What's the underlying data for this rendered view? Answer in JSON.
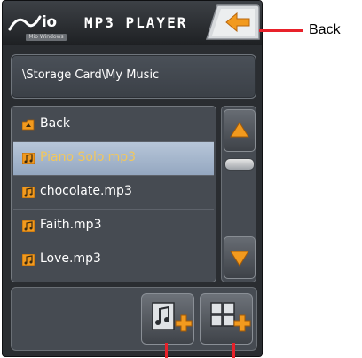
{
  "header": {
    "logo_text": "io",
    "logo_subtext": "Mio Windows",
    "title": "MP3 PLAYER",
    "back_icon": "back-arrow-icon"
  },
  "path": {
    "text": "\\Storage Card\\My Music"
  },
  "list": {
    "items": [
      {
        "label": "Back",
        "icon": "folder-up-icon",
        "selected": false
      },
      {
        "label": "Piano Solo.mp3",
        "icon": "music-file-icon",
        "selected": true
      },
      {
        "label": "chocolate.mp3",
        "icon": "music-file-icon",
        "selected": false
      },
      {
        "label": "Faith.mp3",
        "icon": "music-file-icon",
        "selected": false
      },
      {
        "label": "Love.mp3",
        "icon": "music-file-icon",
        "selected": false
      }
    ]
  },
  "scroll": {
    "up_icon": "arrow-up-icon",
    "down_icon": "arrow-down-icon"
  },
  "toolbar": {
    "add_song_icon": "add-song-icon",
    "add_playlist_icon": "add-playlist-icon"
  },
  "callouts": {
    "back_label": "Back"
  },
  "colors": {
    "accent_orange": "#f29a1e",
    "callout_red": "#e8212a",
    "selected_text": "#f2c75c",
    "panel": "#464b52"
  }
}
